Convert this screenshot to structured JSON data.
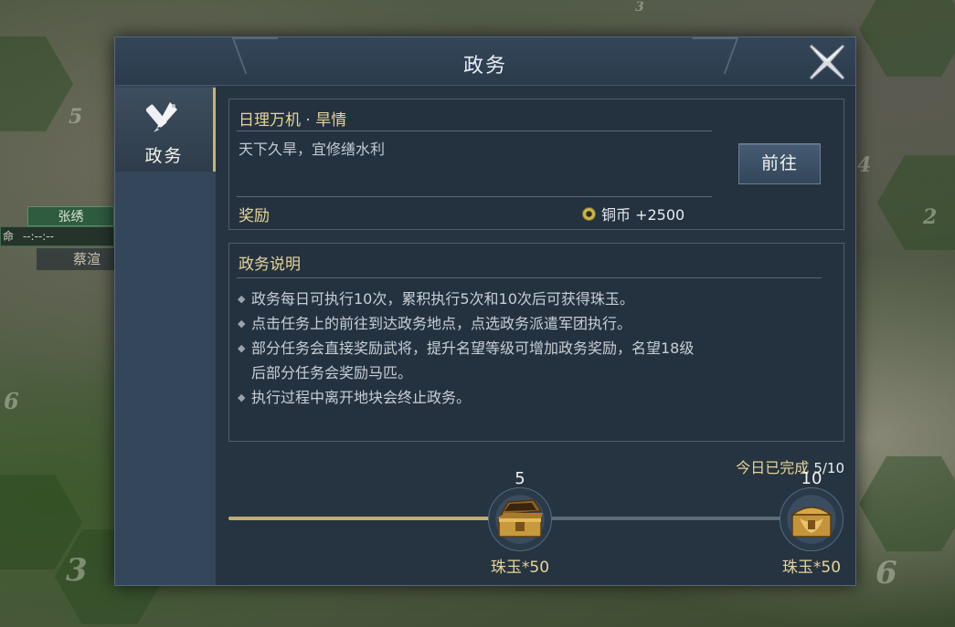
{
  "map": {
    "unit_name": "张绣",
    "unit_bar_text": "--:--:--",
    "unit_bar_left": "命",
    "unit_second_label": "蔡渲",
    "tile_numbers": [
      "3",
      "5",
      "6",
      "2",
      "4",
      "3",
      "6"
    ]
  },
  "dialog": {
    "title": "政务",
    "close_icon": "close-icon"
  },
  "sidebar": {
    "tabs": [
      {
        "label": "政务",
        "icon": "brush-seal-icon",
        "active": true
      }
    ]
  },
  "task": {
    "title": "日理万机 · 旱情",
    "description": "天下久旱，宜修缮水利",
    "reward_label": "奖励",
    "reward_icon": "copper-coin-icon",
    "reward_value": "铜币 +2500",
    "go_button": "前往"
  },
  "explanation": {
    "title": "政务说明",
    "items": [
      {
        "lines": [
          "政务每日可执行10次，累积执行5次和10次后可获得珠玉。"
        ]
      },
      {
        "lines": [
          "点击任务上的前往到达政务地点，点选政务派遣军团执行。"
        ]
      },
      {
        "lines": [
          "部分任务会直接奖励武将，提升名望等级可增加政务奖励，名望18级",
          "后部分任务会奖励马匹。"
        ]
      },
      {
        "lines": [
          "执行过程中离开地块会终止政务。"
        ]
      }
    ]
  },
  "progress": {
    "label": "今日已完成",
    "count": "5/10",
    "completed": 5,
    "total": 10,
    "fill_fraction": 0.45,
    "milestones": [
      {
        "threshold": "5",
        "reward": "珠玉*50",
        "state": "opened",
        "icon": "open-chest-icon"
      },
      {
        "threshold": "10",
        "reward": "珠玉*50",
        "state": "locked",
        "icon": "closed-chest-icon"
      }
    ]
  },
  "colors": {
    "accent_gold": "#e6d49a",
    "progress_fill": "#c4ac70",
    "panel_bg": "#263441"
  }
}
